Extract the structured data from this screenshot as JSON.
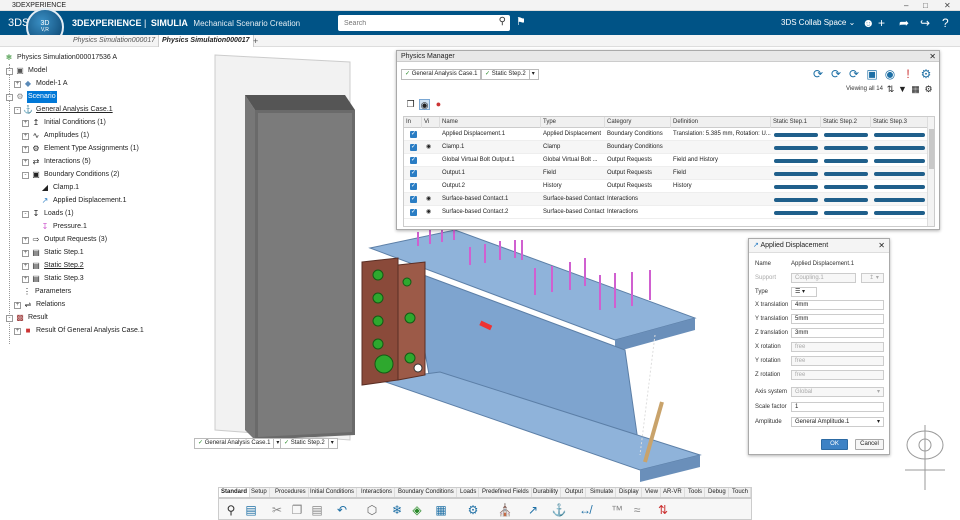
{
  "window": {
    "title": "3DEXPERIENCE"
  },
  "topbar": {
    "compass_version": "V,R",
    "brand_3dx": "3DEXPERIENCE",
    "brand_simulia": "SIMULIA",
    "brand_app": "Mechanical Scenario Creation",
    "search_placeholder": "Search",
    "collab_space": "3DS Collab Space"
  },
  "tabs": [
    {
      "label": "Physics Simulation000017"
    },
    {
      "label": "Physics Simulation000017"
    },
    {
      "label": "+"
    }
  ],
  "tree": [
    {
      "label": "Physics Simulation000017536 A",
      "icon": "simulation-icon"
    },
    {
      "label": "Model",
      "icon": "model-icon"
    },
    {
      "label": "Model-1 A",
      "icon": "part-icon"
    },
    {
      "label": "Scenario",
      "icon": "scenario-icon"
    },
    {
      "label": "General Analysis Case.1",
      "icon": "analysis-case-icon"
    },
    {
      "label": "Initial Conditions (1)",
      "icon": "initial-conditions-icon"
    },
    {
      "label": "Amplitudes (1)",
      "icon": "amplitude-icon"
    },
    {
      "label": "Element Type Assignments (1)",
      "icon": "element-type-icon"
    },
    {
      "label": "Interactions (5)",
      "icon": "interactions-icon"
    },
    {
      "label": "Boundary Conditions (2)",
      "icon": "boundary-conditions-icon"
    },
    {
      "label": "Clamp.1",
      "icon": "clamp-icon"
    },
    {
      "label": "Applied Displacement.1",
      "icon": "displacement-icon"
    },
    {
      "label": "Loads (1)",
      "icon": "loads-icon"
    },
    {
      "label": "Pressure.1",
      "icon": "pressure-icon"
    },
    {
      "label": "Output Requests (3)",
      "icon": "output-icon"
    },
    {
      "label": "Static Step.1",
      "icon": "step-icon"
    },
    {
      "label": "Static Step.2",
      "icon": "step-icon"
    },
    {
      "label": "Static Step.3",
      "icon": "step-icon"
    },
    {
      "label": "Parameters",
      "icon": "parameters-icon"
    },
    {
      "label": "Relations",
      "icon": "relations-icon"
    },
    {
      "label": "Result",
      "icon": "result-icon"
    },
    {
      "label": "Result Of General Analysis Case.1",
      "icon": "result-case-icon"
    }
  ],
  "physics_manager": {
    "title": "Physics Manager",
    "case_combo": "General Analysis Case.1",
    "step_combo": "Static Step.2",
    "viewing": "Viewing all 14",
    "columns": [
      "In",
      "Vi",
      "Name",
      "Type",
      "Category",
      "Definition",
      "Static Step.1",
      "Static Step.2",
      "Static Step.3"
    ],
    "rows": [
      {
        "name": "Applied Displacement.1",
        "type": "Applied Displacement",
        "category": "Boundary Conditions",
        "definition": "Translation: 5.385 mm, Rotation: U...",
        "vis": ""
      },
      {
        "name": "Clamp.1",
        "type": "Clamp",
        "category": "Boundary Conditions",
        "definition": "",
        "vis": "eye"
      },
      {
        "name": "Global Virtual Bolt Output.1",
        "type": "Global Virtual Bolt ...",
        "category": "Output Requests",
        "definition": "Field and History",
        "vis": ""
      },
      {
        "name": "Output.1",
        "type": "Field",
        "category": "Output Requests",
        "definition": "Field",
        "vis": ""
      },
      {
        "name": "Output.2",
        "type": "History",
        "category": "Output Requests",
        "definition": "History",
        "vis": ""
      },
      {
        "name": "Surface-based Contact.1",
        "type": "Surface-based Contact",
        "category": "Interactions",
        "definition": "",
        "vis": "eye"
      },
      {
        "name": "Surface-based Contact.2",
        "type": "Surface-based Contact",
        "category": "Interactions",
        "definition": "",
        "vis": "eye"
      }
    ]
  },
  "applied_displacement": {
    "title": "Applied Displacement",
    "name_label": "Name",
    "name_value": "Applied Displacement.1",
    "support_label": "Support",
    "support_value": "Coupling.1",
    "type_label": "Type",
    "x_translation_label": "X translation",
    "x_translation": "4mm",
    "y_translation_label": "Y translation",
    "y_translation": "5mm",
    "z_translation_label": "Z translation",
    "z_translation": "3mm",
    "x_rotation_label": "X rotation",
    "x_rotation": "free",
    "y_rotation_label": "Y rotation",
    "y_rotation": "free",
    "z_rotation_label": "Z rotation",
    "z_rotation": "free",
    "axis_system_label": "Axis system",
    "axis_system": "Global",
    "scale_factor_label": "Scale factor",
    "scale_factor": "1",
    "amplitude_label": "Amplitude",
    "amplitude": "General Amplitude.1",
    "ok": "OK",
    "cancel": "Cancel"
  },
  "bottom_combos": {
    "case": "General Analysis Case.1",
    "step": "Static Step.2"
  },
  "command_tabs": [
    "Standard",
    "Setup",
    "Procedures",
    "Initial Conditions",
    "Interactions",
    "Boundary Conditions",
    "Loads",
    "Predefined Fields",
    "Durability",
    "Output",
    "Simulate",
    "Display",
    "View",
    "AR-VR",
    "Tools",
    "Debug",
    "Touch"
  ],
  "colors": {
    "topbar": "#005386",
    "selection": "#0078d7",
    "beam": "#7fa7d1",
    "column": "#555555",
    "plate": "#8a4a3a",
    "arrow": "#e080e0"
  }
}
